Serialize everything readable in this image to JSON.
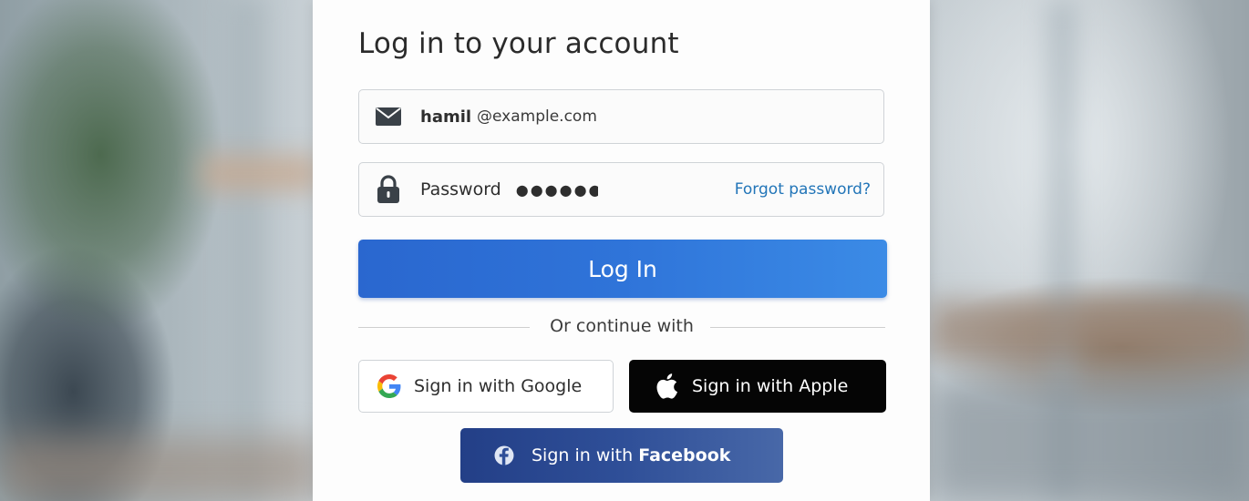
{
  "colors": {
    "primary": "#2f74d9",
    "link": "#2275b8",
    "apple_bg": "#050505",
    "facebook_bg": "#2f4f98"
  },
  "form": {
    "title": "Log in to your account",
    "email": {
      "icon": "envelope-icon",
      "value": "hamil",
      "domain": "@example.com"
    },
    "password": {
      "icon": "lock-icon",
      "label": "Password",
      "value": "●●●●●●",
      "forgot_link": "Forgot password?"
    },
    "login_button": "Log In",
    "divider_text": "Or continue with",
    "social": {
      "google": {
        "icon": "google-icon",
        "label": "Sign in with Google"
      },
      "apple": {
        "icon": "apple-icon",
        "label": "Sign in with Apple"
      },
      "facebook": {
        "icon": "facebook-icon",
        "prefix": "Sign in with ",
        "brand": "Facebook"
      }
    }
  }
}
